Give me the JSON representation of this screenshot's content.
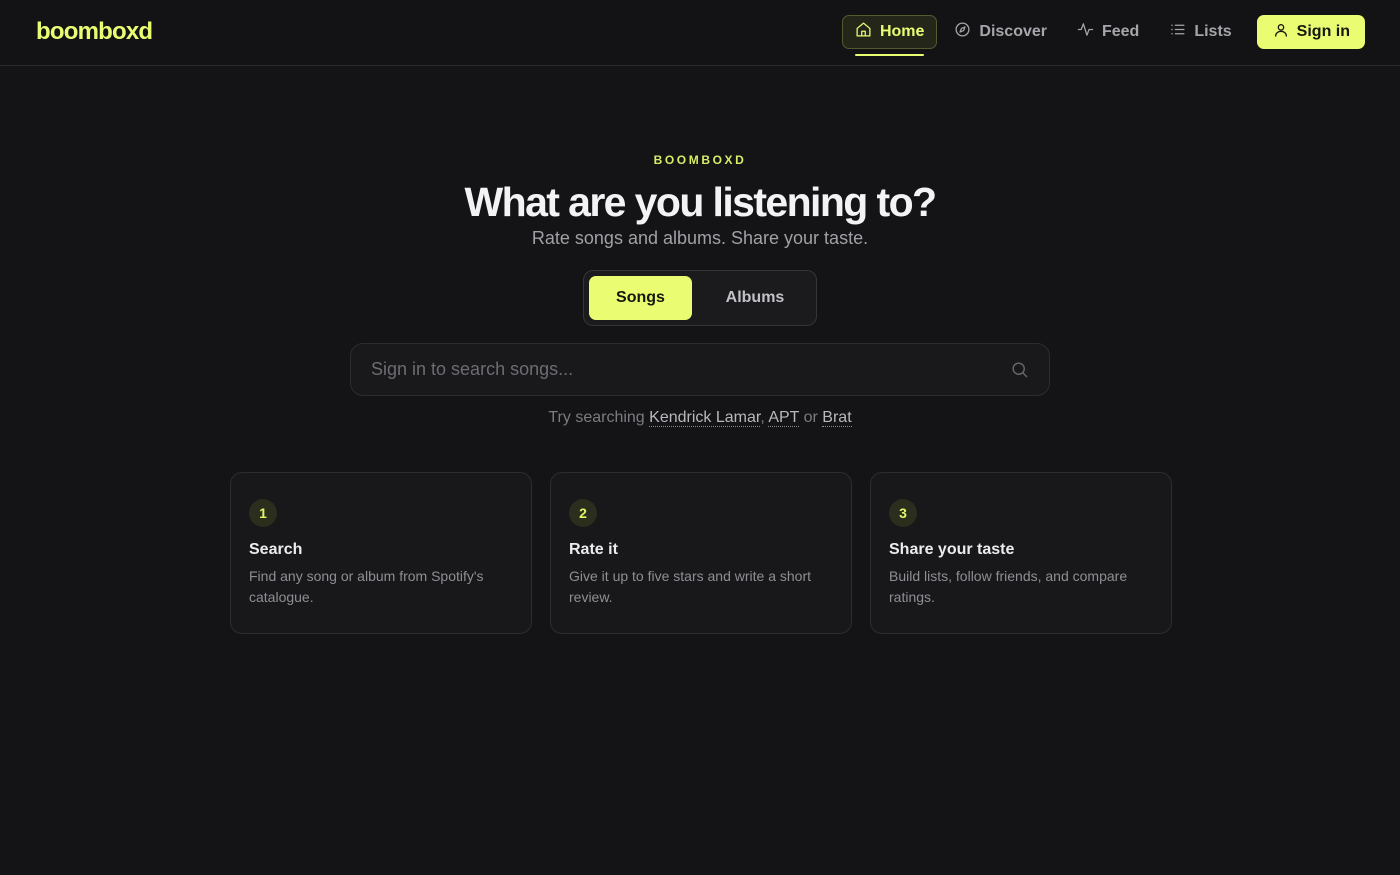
{
  "app": {
    "logo": "boomboxd"
  },
  "nav": {
    "items": [
      {
        "label": "Home",
        "icon": "home-icon",
        "active": true
      },
      {
        "label": "Discover",
        "icon": "compass-icon",
        "active": false
      },
      {
        "label": "Feed",
        "icon": "activity-icon",
        "active": false
      },
      {
        "label": "Lists",
        "icon": "list-icon",
        "active": false
      }
    ],
    "signin": {
      "label": "Sign in",
      "icon": "user-icon"
    }
  },
  "hero": {
    "eyebrow": "BOOMBOXD",
    "title": "What are you listening to?",
    "subtitle": "Rate songs and albums. Share your taste."
  },
  "toggle": {
    "options": [
      "Songs",
      "Albums"
    ],
    "selected": "Songs"
  },
  "search": {
    "placeholder": "Sign in to search songs...",
    "value": "",
    "icon": "search-icon"
  },
  "suggestions": {
    "prefix": "Try searching",
    "links": [
      "Kendrick Lamar",
      "APT",
      "Brat"
    ],
    "sep1": ",",
    "sep2": "or"
  },
  "steps": [
    {
      "number": "1",
      "title": "Search",
      "description": "Find any song or album from Spotify's catalogue."
    },
    {
      "number": "2",
      "title": "Rate it",
      "description": "Give it up to five stars and write a short review."
    },
    {
      "number": "3",
      "title": "Share your taste",
      "description": "Build lists, follow friends, and compare ratings."
    }
  ],
  "colors": {
    "accent": "#e9fc72",
    "background": "#141416",
    "card": "#18181b"
  }
}
